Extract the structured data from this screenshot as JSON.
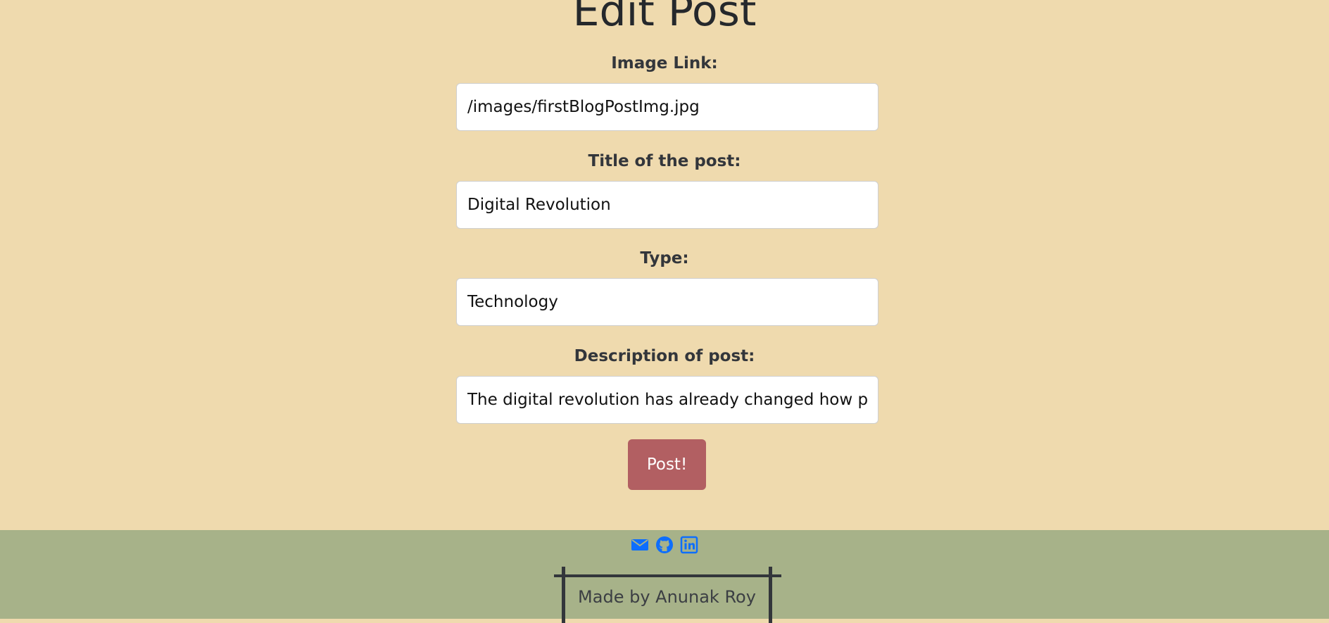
{
  "page": {
    "title": "Edit Post"
  },
  "form": {
    "image_link": {
      "label": "Image Link:",
      "value": "/images/firstBlogPostImg.jpg"
    },
    "title": {
      "label": "Title of the post:",
      "value": "Digital Revolution"
    },
    "type": {
      "label": "Type:",
      "value": "Technology"
    },
    "description": {
      "label": "Description of post:",
      "value": "The digital revolution has already changed how peopl"
    },
    "submit_label": "Post!"
  },
  "footer": {
    "icons": [
      "email-icon",
      "github-icon",
      "linkedin-icon"
    ],
    "credit": "Made by Anunak Roy"
  },
  "colors": {
    "page_background": "#efdaae",
    "footer_background": "#a7b289",
    "button_background": "#b25f62",
    "icon_color": "#0d6efd",
    "frame_color": "#33363b"
  }
}
